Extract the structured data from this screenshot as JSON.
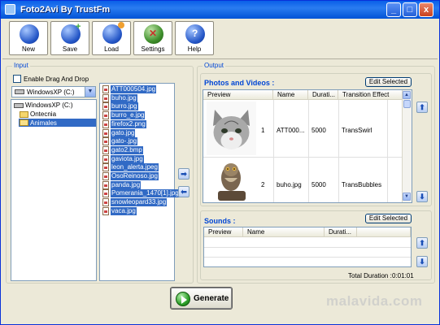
{
  "window": {
    "title": "Foto2Avi By TrustFm",
    "controls": {
      "minimize": "_",
      "maximize": "□",
      "close": "x"
    }
  },
  "toolbar": {
    "new_label": "New",
    "save_label": "Save",
    "load_label": "Load",
    "settings_label": "Settings",
    "help_label": "Help",
    "help_icon_text": "?"
  },
  "input": {
    "group_title": "Input",
    "enable_drag_drop": {
      "label": "Enable Drag And Drop",
      "checked": false
    },
    "drive_select": {
      "value": "WindowsXP (C:)"
    },
    "tree": [
      {
        "label": "WindowsXP (C:)",
        "icon": "drive-icon"
      },
      {
        "label": "Ontecnia",
        "icon": "folder-icon"
      },
      {
        "label": "Animales",
        "icon": "folder-open-icon",
        "selected": true
      }
    ],
    "files": [
      "ATT000504.jpg",
      "buho.jpg",
      "burro.jpg",
      "burro_e.jpg",
      "firefox2.png",
      "gato.jpg",
      "gato-.jpg",
      "gato2.bmp",
      "gaviota.jpg",
      "leon_alerta.jpeg",
      "OsoReinoso.jpg",
      "panda.jpg",
      "Pomerania_1470[1].jpg",
      "snowleopard33.jpg",
      "vaca.jpg"
    ],
    "transfer_right_icon": "arrow-right-icon",
    "transfer_left_icon": "arrow-left-icon"
  },
  "output": {
    "group_title": "Output",
    "photos": {
      "title": "Photos and Videos :",
      "edit_button": "Edit Selected",
      "columns": [
        "Preview",
        "Name",
        "Durati...",
        "Transition Effect"
      ],
      "rows": [
        {
          "index": "1",
          "name": "ATT000...",
          "duration": "5000",
          "transition": "TransSwirl",
          "preview": "kitten-photo"
        },
        {
          "index": "2",
          "name": "buho.jpg",
          "duration": "5000",
          "transition": "TransBubbles",
          "preview": "owl-photo"
        }
      ],
      "move_up_icon": "arrow-up-icon",
      "move_down_icon": "arrow-down-icon"
    },
    "sounds": {
      "title": "Sounds :",
      "edit_button": "Edit Selected",
      "columns": [
        "Preview",
        "Name",
        "Durati..."
      ],
      "rows": []
    },
    "total_duration_label": "Total Duration :",
    "total_duration_value": "0:01:01"
  },
  "generate": {
    "label": "Generate"
  },
  "watermark": "malavida.com",
  "colors": {
    "accent": "#0046d5",
    "selection": "#316ac5",
    "titlebar": "#0a5fe8",
    "window_bg": "#ece9d8"
  }
}
